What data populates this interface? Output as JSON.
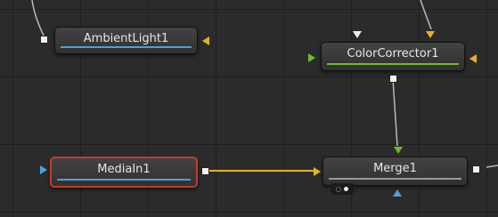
{
  "nodes": {
    "ambient_light": {
      "label": "AmbientLight1",
      "bar_color": "#4aa3d9"
    },
    "color_corrector": {
      "label": "ColorCorrector1",
      "bar_color": "#6cbb2f"
    },
    "media_in": {
      "label": "MediaIn1",
      "bar_color": "#4aa3d9",
      "selected": true
    },
    "merge": {
      "label": "Merge1",
      "bar_color": "#9a9a9a"
    }
  },
  "colors": {
    "background": "#2b2b2b",
    "wire": "#b9b9b9",
    "active_wire": "#e6b41e",
    "selection": "#c43a2f"
  }
}
